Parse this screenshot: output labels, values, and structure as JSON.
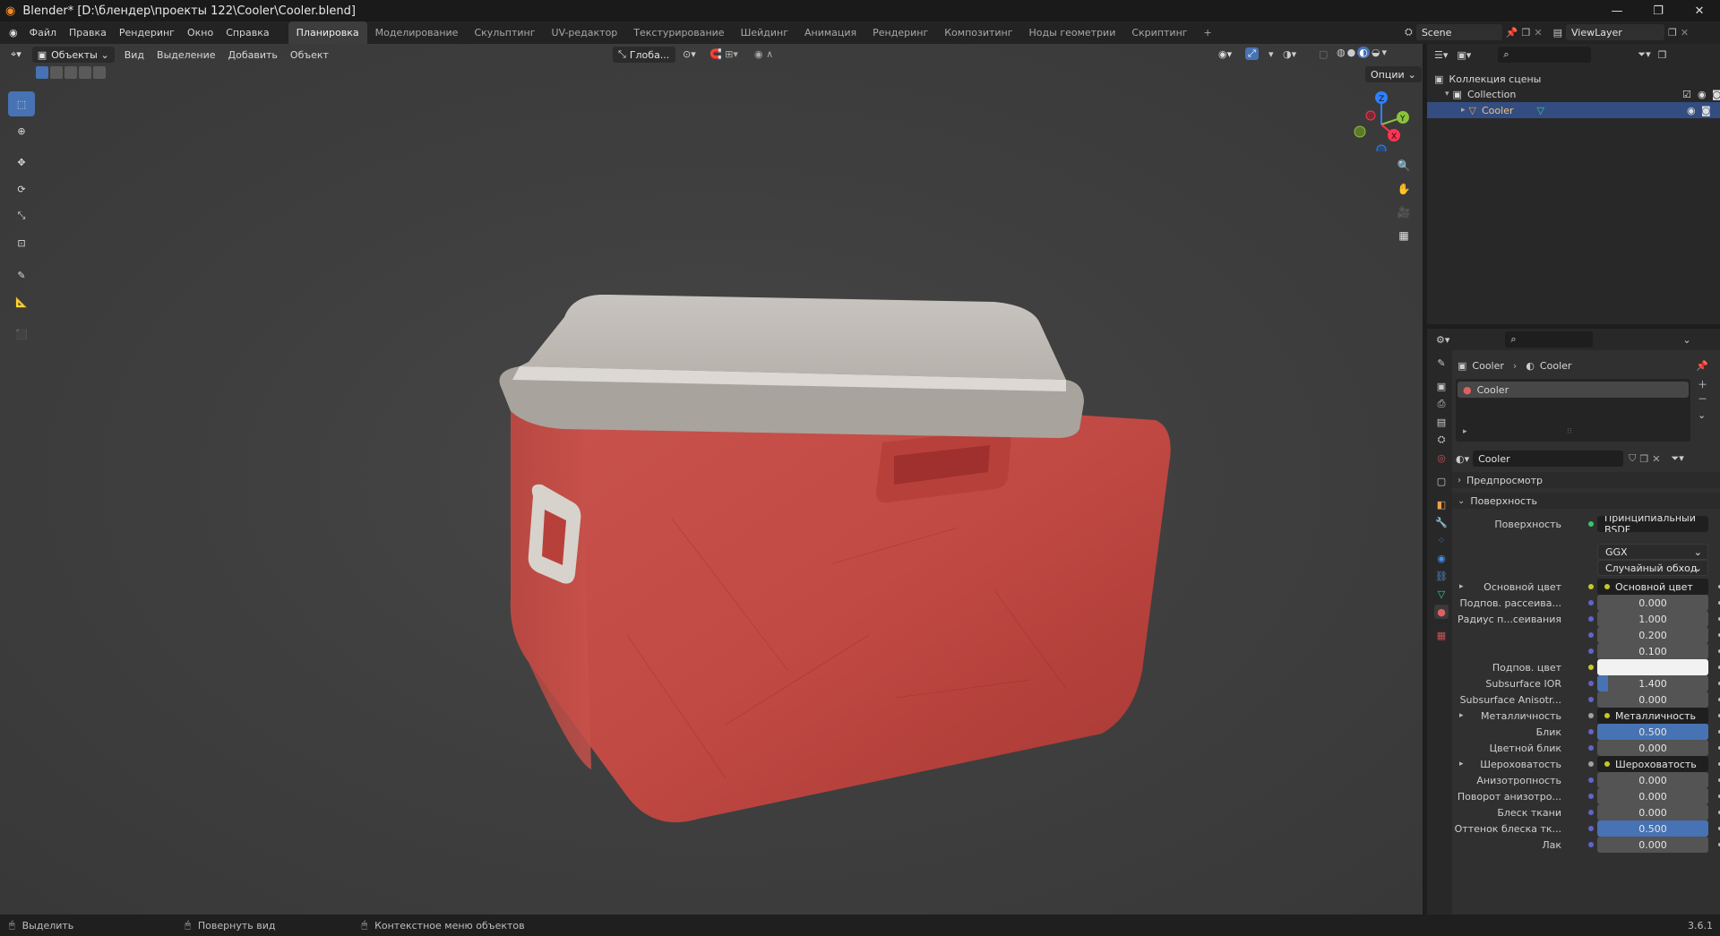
{
  "app": {
    "title": "Blender* [D:\\блендер\\проекты 122\\Cooler\\Cooler.blend]",
    "version": "3.6.1",
    "colors": {
      "accent": "#4772b3",
      "panel": "#282828",
      "viewport": "#404040"
    }
  },
  "menubar": {
    "items": [
      "Файл",
      "Правка",
      "Рендеринг",
      "Окно",
      "Справка"
    ],
    "workspaces": [
      "Планировка",
      "Моделирование",
      "Скульптинг",
      "UV-редактор",
      "Текстурирование",
      "Шейдинг",
      "Анимация",
      "Рендеринг",
      "Композитинг",
      "Ноды геометрии",
      "Скриптинг"
    ],
    "active_workspace": 0,
    "add_tab": "+",
    "scene": "Scene",
    "view_layer": "ViewLayer"
  },
  "viewport": {
    "mode": "Объекты",
    "menus": [
      "Вид",
      "Выделение",
      "Добавить",
      "Объект"
    ],
    "transform_orientation": "Глоба...",
    "options": "Опции",
    "gizmo": {
      "x": "X",
      "y": "Y",
      "z": "Z"
    }
  },
  "outliner": {
    "root": "Коллекция сцены",
    "collection": "Collection",
    "object": "Cooler"
  },
  "properties": {
    "breadcrumb": [
      "Cooler",
      "Cooler"
    ],
    "material_slot": "Cooler",
    "material_name": "Cooler",
    "panels": {
      "preview": "Предпросмотр",
      "surface": "Поверхность"
    },
    "surface_label": "Поверхность",
    "surface_value": "Принципиальный BSDF",
    "distribution": "GGX",
    "subsurface_method": "Случайный обход",
    "fields": [
      {
        "label": "Основной цвет",
        "value": "Основной цвет",
        "kind": "link",
        "expand": true
      },
      {
        "label": "Подпов. рассеива...",
        "value": "0.000",
        "kind": "num",
        "fill": 0
      },
      {
        "label": "Радиус п...сеивания",
        "value": "1.000",
        "kind": "num",
        "fill": 0
      },
      {
        "label": "",
        "value": "0.200",
        "kind": "num",
        "fill": 0
      },
      {
        "label": "",
        "value": "0.100",
        "kind": "num",
        "fill": 0
      },
      {
        "label": "Подпов. цвет",
        "value": "",
        "kind": "color"
      },
      {
        "label": "Subsurface IOR",
        "value": "1.400",
        "kind": "num",
        "fill": 0.1
      },
      {
        "label": "Subsurface Anisotr...",
        "value": "0.000",
        "kind": "num",
        "fill": 0
      },
      {
        "label": "Металличность",
        "value": "Металличность",
        "kind": "link",
        "expand": true
      },
      {
        "label": "Блик",
        "value": "0.500",
        "kind": "num",
        "fill": 1
      },
      {
        "label": "Цветной блик",
        "value": "0.000",
        "kind": "num",
        "fill": 0
      },
      {
        "label": "Шероховатость",
        "value": "Шероховатость",
        "kind": "link",
        "expand": true
      },
      {
        "label": "Анизотропность",
        "value": "0.000",
        "kind": "num",
        "fill": 0
      },
      {
        "label": "Поворот анизотро...",
        "value": "0.000",
        "kind": "num",
        "fill": 0
      },
      {
        "label": "Блеск ткани",
        "value": "0.000",
        "kind": "num",
        "fill": 0
      },
      {
        "label": "Оттенок блеска тк...",
        "value": "0.500",
        "kind": "num",
        "fill": 1
      },
      {
        "label": "Лак",
        "value": "0.000",
        "kind": "num",
        "fill": 0
      }
    ]
  },
  "statusbar": {
    "items": [
      "Выделить",
      "Повернуть вид",
      "Контекстное меню объектов"
    ]
  }
}
